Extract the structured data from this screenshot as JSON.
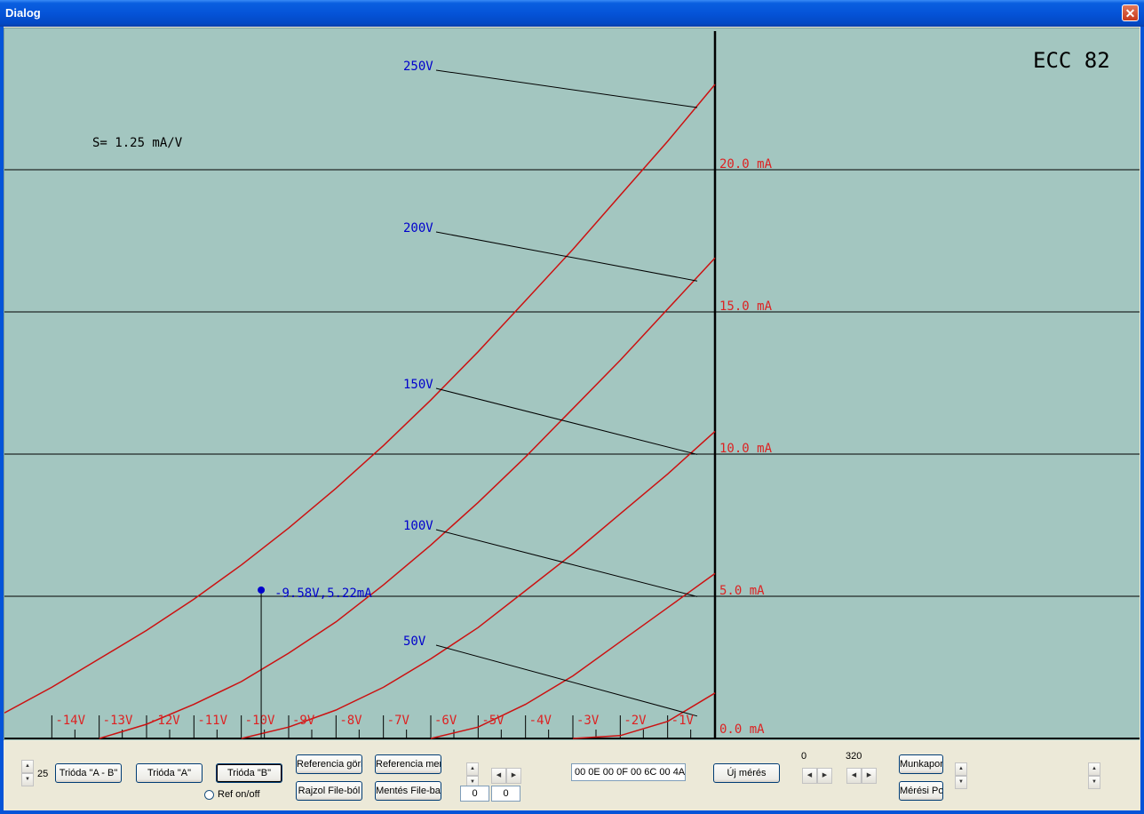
{
  "window": {
    "title": "Dialog",
    "close_glyph": "✕"
  },
  "plot": {
    "tube_label": "ECC 82",
    "transconductance": "S= 1.25 mA/V",
    "cursor_label": "-9.58V,5.22mA",
    "plate_voltage_labels": [
      "250V",
      "200V",
      "150V",
      "100V",
      "50V"
    ],
    "current_labels": [
      "20.0 mA",
      "15.0 mA",
      "10.0 mA",
      "5.0 mA",
      "0.0 mA"
    ],
    "grid_labels": [
      "-14V",
      "-13V",
      "-12V",
      "-11V",
      "-10V",
      "-9V",
      "-8V",
      "-7V",
      "-6V",
      "-5V",
      "-4V",
      "-3V",
      "-2V",
      "-1V"
    ],
    "colors": {
      "background": "#a3c6c0",
      "curve": "#cc1111",
      "plate_label": "#0000cc",
      "current_label": "#dd2222"
    }
  },
  "chart_data": {
    "type": "line",
    "xlabel": "",
    "ylabel": "",
    "xlim": [
      -15,
      0
    ],
    "ylim": [
      0,
      20
    ],
    "x_ticks": [
      "-14V",
      "-13V",
      "-12V",
      "-11V",
      "-10V",
      "-9V",
      "-8V",
      "-7V",
      "-6V",
      "-5V",
      "-4V",
      "-3V",
      "-2V",
      "-1V"
    ],
    "y_ticks": [
      "0.0 mA",
      "5.0 mA",
      "10.0 mA",
      "15.0 mA",
      "20.0 mA"
    ],
    "series": [
      {
        "name": "250V",
        "x": [
          -15,
          -14,
          -13,
          -12,
          -11,
          -10,
          -9,
          -8,
          -7,
          -6,
          -5,
          -4,
          -3,
          -2,
          -1,
          0
        ],
        "values": [
          0.9,
          1.8,
          2.8,
          3.8,
          4.9,
          6.1,
          7.4,
          8.8,
          10.3,
          11.9,
          13.6,
          15.4,
          17.2,
          19.1,
          21.0,
          23.0
        ]
      },
      {
        "name": "200V",
        "x": [
          -13,
          -12,
          -11,
          -10,
          -9,
          -8,
          -7,
          -6,
          -5,
          -4,
          -3,
          -2,
          -1,
          0
        ],
        "values": [
          0.0,
          0.5,
          1.2,
          2.0,
          3.0,
          4.1,
          5.4,
          6.8,
          8.3,
          9.9,
          11.6,
          13.3,
          15.1,
          16.9
        ]
      },
      {
        "name": "150V",
        "x": [
          -10,
          -9,
          -8,
          -7,
          -6,
          -5,
          -4,
          -3,
          -2,
          -1,
          0
        ],
        "values": [
          0.0,
          0.4,
          1.0,
          1.8,
          2.8,
          3.9,
          5.2,
          6.5,
          7.9,
          9.3,
          10.8
        ]
      },
      {
        "name": "100V",
        "x": [
          -6,
          -5,
          -4,
          -3,
          -2,
          -1,
          0
        ],
        "values": [
          0.0,
          0.4,
          1.2,
          2.2,
          3.4,
          4.6,
          5.8
        ]
      },
      {
        "name": "50V",
        "x": [
          -3,
          -2,
          -1,
          0
        ],
        "values": [
          0.0,
          0.1,
          0.6,
          1.6
        ]
      }
    ],
    "marker": {
      "x": -9.58,
      "y": 5.22,
      "label": "-9.58V,5.22mA"
    },
    "grid": true,
    "legend": "inline"
  },
  "controls": {
    "spin_value_left": "25",
    "btn_trioda_ab": "Trióda \"A - B\"",
    "btn_trioda_a": "Trióda  \"A\"",
    "btn_trioda_b": "Trióda  \"B\"",
    "radio_ref": "Ref on/off",
    "btn_referencia_gorbe": "Referencia görbe",
    "btn_referencia_mentes": "Referencia mentés",
    "btn_rajzol": "Rajzol File-ból",
    "btn_mentes_file": "Mentés File-ba",
    "field_a": "0",
    "field_b": "0",
    "hex_field": "00 0E 00 0F 00 6C 00 4A",
    "btn_uj_meres": "Új mérés",
    "range_min": "0",
    "range_max": "320",
    "btn_munkapont": "Munkapont",
    "btn_meresi_pont": "Mérési Pont"
  }
}
